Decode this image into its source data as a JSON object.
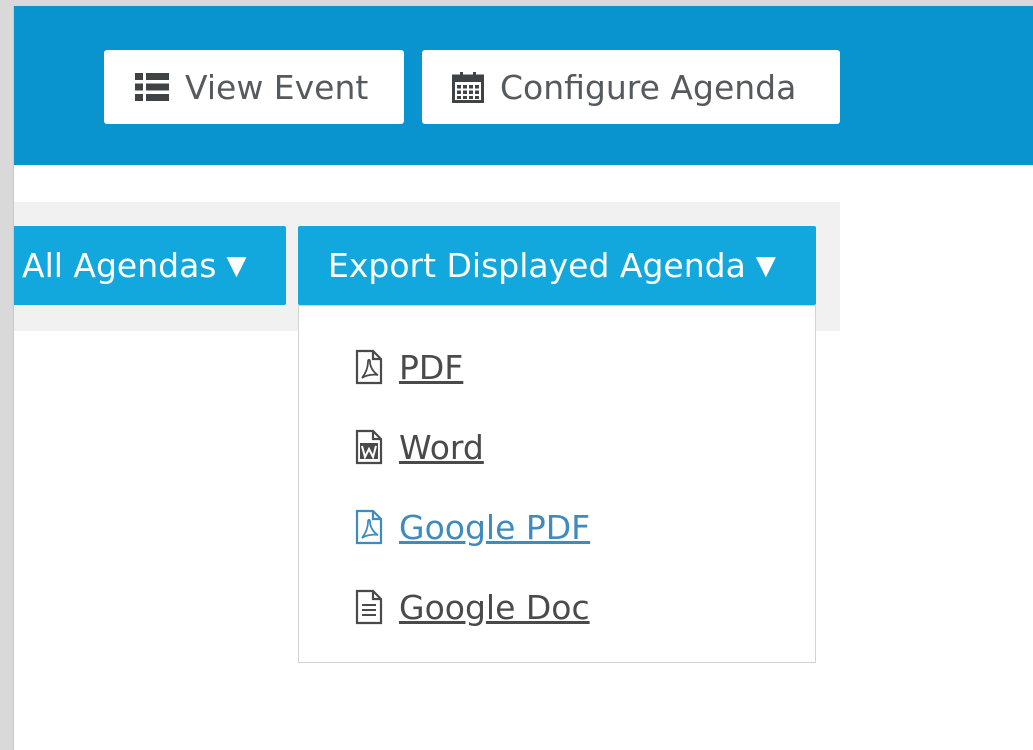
{
  "header": {
    "view_event_label": "View Event",
    "configure_agenda_label": "Configure Agenda"
  },
  "toolbar": {
    "all_agendas_label": "All Agendas",
    "export_label": "Export Displayed Agenda",
    "caret": "▼"
  },
  "export_menu": {
    "items": [
      {
        "label": "PDF",
        "icon": "pdf-file-icon"
      },
      {
        "label": "Word",
        "icon": "word-file-icon"
      },
      {
        "label": "Google PDF",
        "icon": "pdf-file-icon",
        "hovered": true
      },
      {
        "label": "Google Doc",
        "icon": "document-file-icon"
      }
    ]
  },
  "colors": {
    "header_bg": "#0a94cf",
    "tab_bg": "#13a8dd",
    "hover_link": "#3d8bbf",
    "text": "#4a4a4a"
  }
}
